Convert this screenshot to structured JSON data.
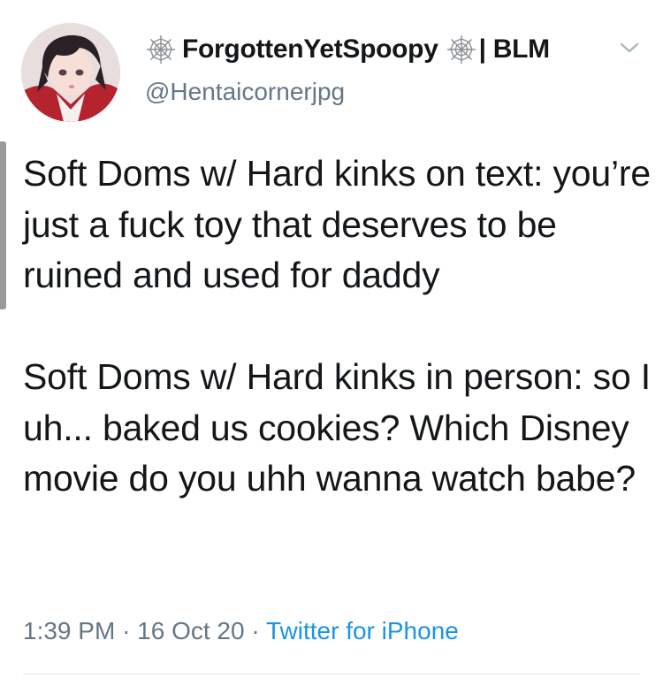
{
  "user": {
    "display_name": "ForgottenYetSpoopy",
    "name_suffix": "| BLM",
    "username": "@Hentaicornerjpg"
  },
  "tweet": {
    "paragraph_1": "Soft Doms w/ Hard kinks on text: you’re just a fuck toy that deserves to be ruined and used for daddy",
    "paragraph_2": "Soft Doms w/ Hard kinks in person: so I uh... baked us cookies? Which Disney movie do you uhh wanna watch babe?"
  },
  "meta": {
    "time": "1:39 PM",
    "separator": "·",
    "date": "16 Oct 20",
    "source": "Twitter for iPhone"
  },
  "icons": {
    "name_decoration": "spider-web-icon",
    "menu": "chevron-down-icon"
  },
  "colors": {
    "text": "#14171a",
    "secondary": "#657786",
    "link": "#1b95e0"
  }
}
